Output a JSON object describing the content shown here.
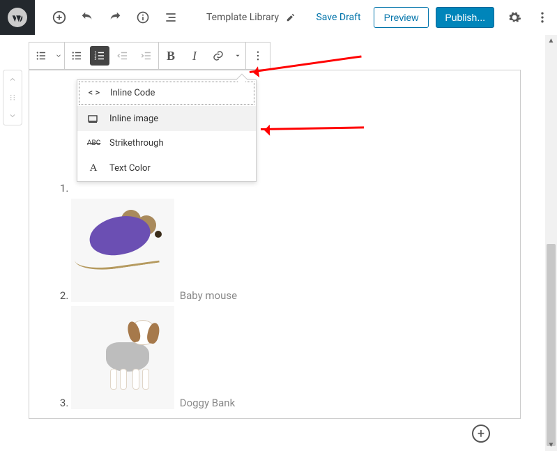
{
  "top": {
    "doc_title": "Template Library",
    "save_draft": "Save Draft",
    "preview": "Preview",
    "publish": "Publish..."
  },
  "dropdown": {
    "items": [
      {
        "label": "Inline Code",
        "icon": "code"
      },
      {
        "label": "Inline image",
        "icon": "image"
      },
      {
        "label": "Strikethrough",
        "icon": "strike"
      },
      {
        "label": "Text Color",
        "icon": "textcolor"
      }
    ]
  },
  "list": {
    "item1_label": "",
    "item2_label": "Baby mouse",
    "item3_label": "Doggy Bank"
  }
}
